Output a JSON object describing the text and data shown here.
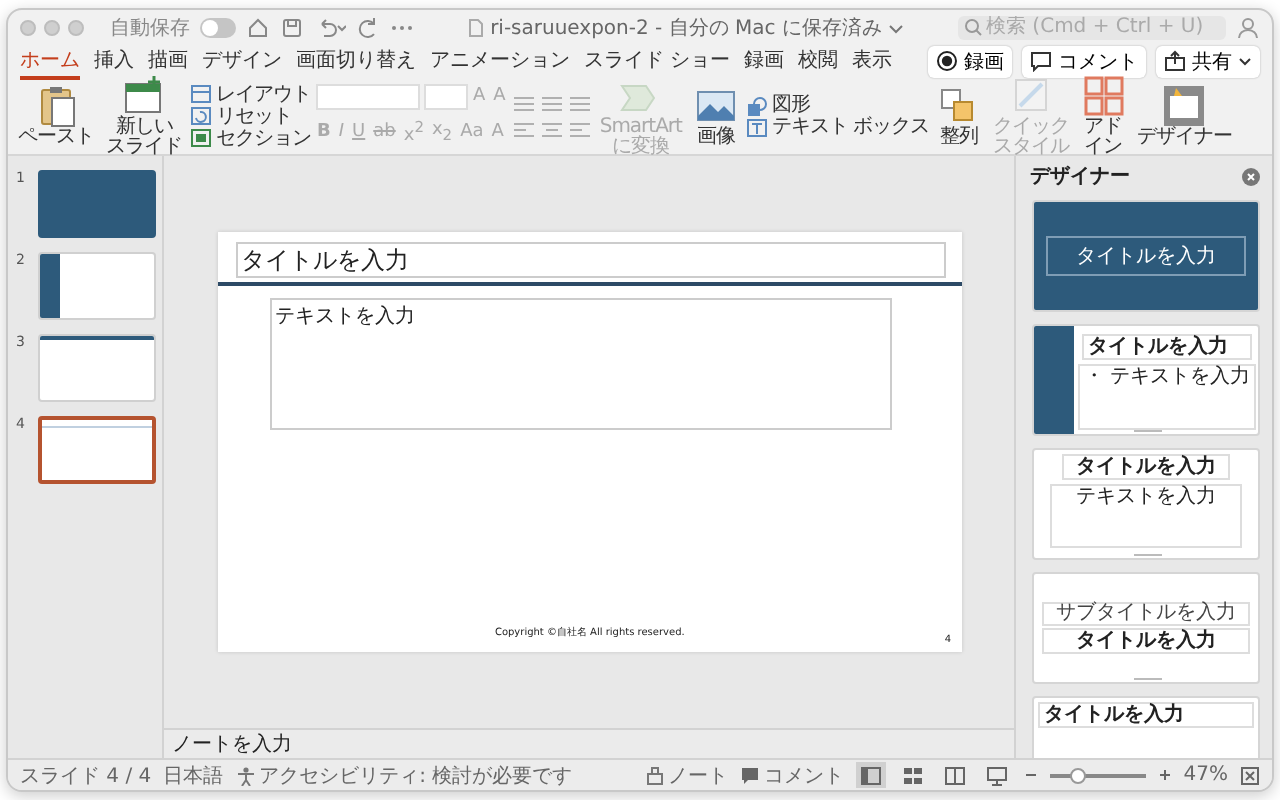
{
  "window": {
    "title": "ri-saruuexpon-2 - 自分の Mac に保存済み"
  },
  "autosave": {
    "label": "自動保存",
    "on": false
  },
  "search": {
    "placeholder": "検索 (Cmd + Ctrl + U)"
  },
  "tabs": [
    {
      "label": "ホーム",
      "selected": true
    },
    {
      "label": "挿入",
      "selected": false
    },
    {
      "label": "描画",
      "selected": false
    },
    {
      "label": "デザイン",
      "selected": false
    },
    {
      "label": "画面切り替え",
      "selected": false
    },
    {
      "label": "アニメーション",
      "selected": false
    },
    {
      "label": "スライド ショー",
      "selected": false
    },
    {
      "label": "録画",
      "selected": false
    },
    {
      "label": "校閲",
      "selected": false
    },
    {
      "label": "表示",
      "selected": false
    }
  ],
  "actions": [
    {
      "label": "録画"
    },
    {
      "label": "コメント"
    },
    {
      "label": "共有"
    }
  ],
  "ribbon": [
    {
      "kind": "large",
      "label": "ペースト",
      "disabled": false
    },
    {
      "kind": "large",
      "lines": [
        "新しい",
        "スライド"
      ],
      "disabled": false
    },
    {
      "kind": "stack",
      "items": [
        "レイアウト",
        "リセット",
        "セクション"
      ]
    },
    {
      "kind": "font",
      "disabled": true,
      "row1": [
        "A",
        "A"
      ],
      "row2": [
        "B",
        "I",
        "U",
        "ab",
        "x$^{2}$",
        "x$_{2}$",
        "Aa",
        "A"
      ]
    },
    {
      "kind": "paragraph",
      "disabled": true
    },
    {
      "kind": "large",
      "lines": [
        "SmartArt",
        "に変換"
      ],
      "disabled": true
    },
    {
      "kind": "large",
      "label": "画像",
      "disabled": false
    },
    {
      "kind": "stack",
      "items": [
        "図形",
        "テキスト ボックス"
      ]
    },
    {
      "kind": "large",
      "label": "整列",
      "disabled": false
    },
    {
      "kind": "large",
      "lines": [
        "クイック",
        "スタイル"
      ],
      "disabled": true
    },
    {
      "kind": "large",
      "lines": [
        "アド",
        "イン"
      ],
      "disabled": false
    },
    {
      "kind": "large",
      "label": "デザイナー",
      "disabled": false
    }
  ],
  "slides": [
    {
      "number": "1",
      "kind": "title",
      "selected": false
    },
    {
      "number": "2",
      "kind": "sidebar",
      "selected": false
    },
    {
      "number": "3",
      "kind": "topbar",
      "selected": false
    },
    {
      "number": "4",
      "kind": "plain",
      "selected": true
    }
  ],
  "slide": {
    "title": "タイトルを入力",
    "body": "テキストを入力",
    "footer": "Copyright ©自社名 All rights reserved.",
    "page_number": "4"
  },
  "notes": {
    "placeholder": "ノートを入力"
  },
  "designer": {
    "title": "デザイナー",
    "designs": [
      {
        "kind": "title-dark",
        "title": "タイトルを入力"
      },
      {
        "kind": "sidebar",
        "title": "タイトルを入力",
        "body": "・ テキストを入力"
      },
      {
        "kind": "centered",
        "title": "タイトルを入力",
        "body": "テキストを入力"
      },
      {
        "kind": "subtitle",
        "subtitle": "サブタイトルを入力",
        "title": "タイトルを入力"
      },
      {
        "kind": "plain-title",
        "title": "タイトルを入力"
      }
    ]
  },
  "status_bar": {
    "slide": "スライド 4 / 4",
    "language": "日本語",
    "accessibility": "アクセシビリティ: 検討が必要です",
    "notes": "ノート",
    "comments": "コメント",
    "views": [
      {
        "selected": true
      },
      {
        "selected": false
      },
      {
        "selected": false
      },
      {
        "selected": false
      }
    ],
    "zoom": {
      "level": 0.3,
      "reading": "47%"
    }
  }
}
